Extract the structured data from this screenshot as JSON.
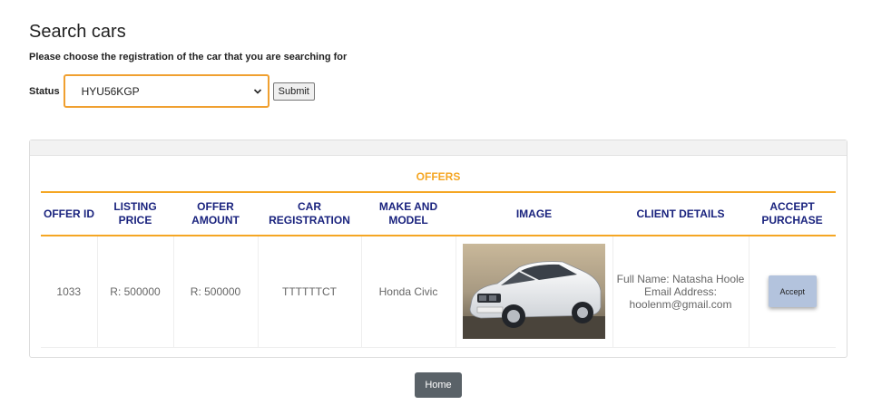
{
  "page": {
    "title": "Search cars",
    "subtitle": "Please choose the registration of the car that you are searching for"
  },
  "search": {
    "status_label": "Status",
    "selected_value": "HYU56KGP",
    "submit_label": "Submit"
  },
  "offers": {
    "title": "OFFERS",
    "columns": [
      "OFFER ID",
      "LISTING PRICE",
      "OFFER AMOUNT",
      "CAR REGISTRATION",
      "MAKE AND MODEL",
      "IMAGE",
      "CLIENT DETAILS",
      "ACCEPT PURCHASE"
    ],
    "rows": [
      {
        "offer_id": "1033",
        "listing_price": "R: 500000",
        "offer_amount": "R: 500000",
        "car_registration": "TTTTTTCT",
        "make_model": "Honda Civic",
        "client_name": "Full Name: Natasha Hoole",
        "client_email": "Email Address: hoolenm@gmail.com",
        "accept_label": "Accept"
      }
    ]
  },
  "footer": {
    "home_label": "Home"
  },
  "colors": {
    "accent": "#f5a623",
    "header_text": "#1a237e",
    "accept_button": "#b3c3dd",
    "home_button": "#5a6268"
  },
  "icons": {
    "select_arrow": "chevron-down-icon",
    "car_image": "car-photo"
  }
}
